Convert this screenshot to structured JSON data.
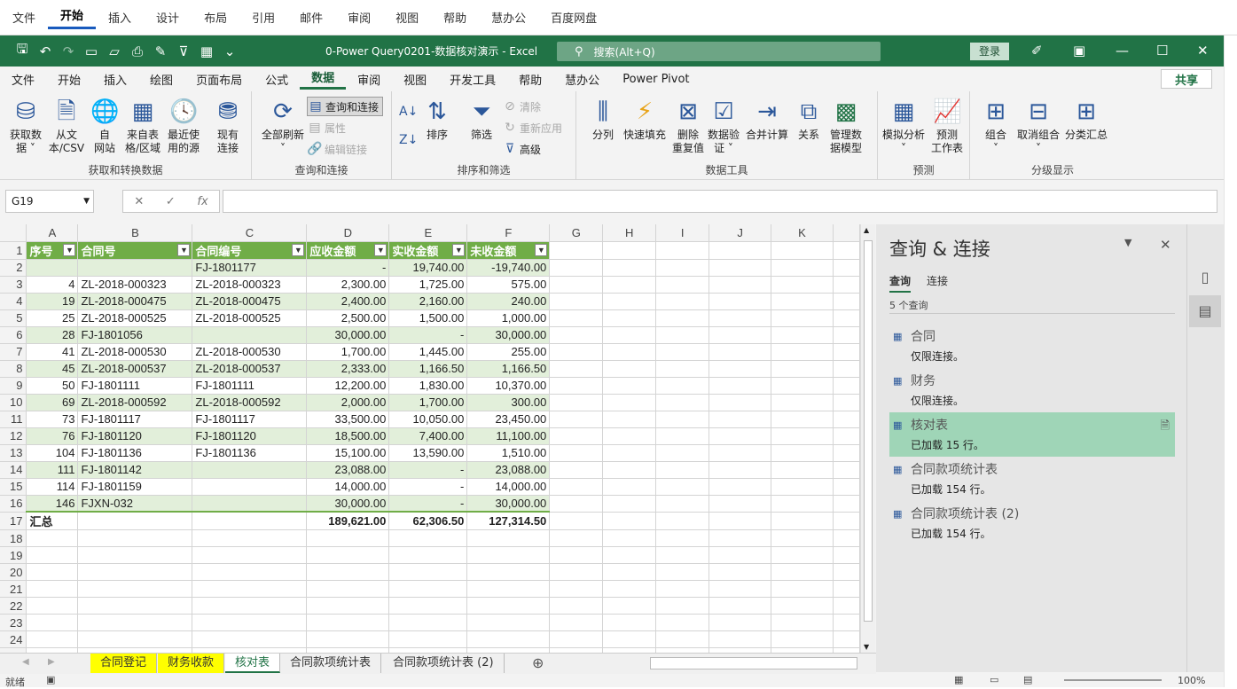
{
  "word_tabs": [
    "文件",
    "开始",
    "插入",
    "设计",
    "布局",
    "引用",
    "邮件",
    "审阅",
    "视图",
    "帮助",
    "慧办公",
    "百度网盘"
  ],
  "word_active": "开始",
  "title": "0-Power Query0201-数据核对演示  -  Excel",
  "search_placeholder": "搜索(Alt+Q)",
  "login": "登录",
  "tabs": [
    "文件",
    "开始",
    "插入",
    "绘图",
    "页面布局",
    "公式",
    "数据",
    "审阅",
    "视图",
    "开发工具",
    "帮助",
    "慧办公",
    "Power Pivot"
  ],
  "active_tab": "数据",
  "share": "共享",
  "ribbon": {
    "g1": {
      "label": "获取和转换数据",
      "b": [
        "获取数\n据 ˅",
        "从文\n本/CSV",
        "自\n网站",
        "来自表\n格/区域",
        "最近使\n用的源",
        "现有\n连接"
      ]
    },
    "g2": {
      "label": "查询和连接",
      "refresh": "全部刷新",
      "s": [
        "查询和连接",
        "属性",
        "编辑链接"
      ]
    },
    "g3": {
      "label": "排序和筛选",
      "sort": "排序",
      "filter": "筛选",
      "s": [
        "清除",
        "重新应用",
        "高级"
      ]
    },
    "g4": {
      "label": "数据工具",
      "b": [
        "分列",
        "快速填充",
        "删除\n重复值",
        "数据验\n证 ˅",
        "合并计算",
        "关系",
        "管理数\n据模型"
      ]
    },
    "g5": {
      "label": "预测",
      "b": [
        "模拟分析",
        "预测\n工作表"
      ]
    },
    "g6": {
      "label": "分级显示",
      "b": [
        "组合",
        "取消组合",
        "分类汇总"
      ]
    }
  },
  "namebox": "G19",
  "columns": [
    "A",
    "B",
    "C",
    "D",
    "E",
    "F",
    "G",
    "H",
    "I",
    "J",
    "K"
  ],
  "headers": [
    "序号",
    "合同号",
    "合同编号",
    "应收金额",
    "实收金额",
    "未收金额"
  ],
  "rows": [
    [
      "",
      "",
      "FJ-1801177",
      "-",
      "19,740.00",
      "-19,740.00"
    ],
    [
      "4",
      "ZL-2018-000323",
      "ZL-2018-000323",
      "2,300.00",
      "1,725.00",
      "575.00"
    ],
    [
      "19",
      "ZL-2018-000475",
      "ZL-2018-000475",
      "2,400.00",
      "2,160.00",
      "240.00"
    ],
    [
      "25",
      "ZL-2018-000525",
      "ZL-2018-000525",
      "2,500.00",
      "1,500.00",
      "1,000.00"
    ],
    [
      "28",
      "FJ-1801056",
      "",
      "30,000.00",
      "-",
      "30,000.00"
    ],
    [
      "41",
      "ZL-2018-000530",
      "ZL-2018-000530",
      "1,700.00",
      "1,445.00",
      "255.00"
    ],
    [
      "45",
      "ZL-2018-000537",
      "ZL-2018-000537",
      "2,333.00",
      "1,166.50",
      "1,166.50"
    ],
    [
      "50",
      "FJ-1801111",
      "FJ-1801111",
      "12,200.00",
      "1,830.00",
      "10,370.00"
    ],
    [
      "69",
      "ZL-2018-000592",
      "ZL-2018-000592",
      "2,000.00",
      "1,700.00",
      "300.00"
    ],
    [
      "73",
      "FJ-1801117",
      "FJ-1801117",
      "33,500.00",
      "10,050.00",
      "23,450.00"
    ],
    [
      "76",
      "FJ-1801120",
      "FJ-1801120",
      "18,500.00",
      "7,400.00",
      "11,100.00"
    ],
    [
      "104",
      "FJ-1801136",
      "FJ-1801136",
      "15,100.00",
      "13,590.00",
      "1,510.00"
    ],
    [
      "111",
      "FJ-1801142",
      "",
      "23,088.00",
      "-",
      "23,088.00"
    ],
    [
      "114",
      "FJ-1801159",
      "",
      "14,000.00",
      "-",
      "14,000.00"
    ],
    [
      "146",
      "FJXN-032",
      "",
      "30,000.00",
      "-",
      "30,000.00"
    ]
  ],
  "total": [
    "汇总",
    "",
    "",
    "189,621.00",
    "62,306.50",
    "127,314.50"
  ],
  "pane": {
    "title": "查询 & 连接",
    "tab_q": "查询",
    "tab_c": "连接",
    "count": "5 个查询",
    "items": [
      {
        "name": "合同",
        "status": "仅限连接。"
      },
      {
        "name": "财务",
        "status": "仅限连接。"
      },
      {
        "name": "核对表",
        "status": "已加载 15 行。"
      },
      {
        "name": "合同款项统计表",
        "status": "已加载 154 行。"
      },
      {
        "name": "合同款项统计表 (2)",
        "status": "已加载 154 行。"
      }
    ]
  },
  "sheets": [
    "合同登记",
    "财务收款",
    "核对表",
    "合同款项统计表",
    "合同款项统计表 (2)"
  ],
  "status": {
    "ready": "就绪",
    "zoom": "100%"
  }
}
